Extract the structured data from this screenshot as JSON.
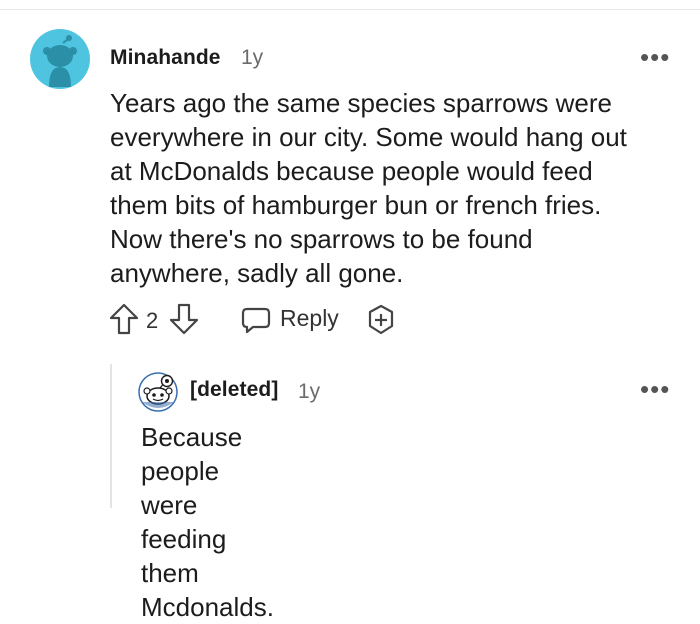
{
  "comments": [
    {
      "author": "Minahande",
      "age": "1y",
      "body_lines": [
        "Years ago the same species sparrows were",
        "everywhere in our city. Some would hang out",
        "at McDonalds because people would feed",
        "them bits of hamburger bun or french fries.",
        "Now there's no sparrows to be found",
        "anywhere, sadly all gone."
      ],
      "votes": "2",
      "reply_label": "Reply",
      "more_label": "•••"
    },
    {
      "author": "[deleted]",
      "age": "1y",
      "body_lines": [
        "Because people were feeding them",
        "Mcdonalds."
      ],
      "more_label": "•••"
    }
  ],
  "colors": {
    "avatar1_bg": "#4fc4e0",
    "avatar1_alien": "#2b8fa8",
    "text": "#1c1c1c",
    "muted": "#6b6b6b",
    "thread_line": "#e3e3e3"
  },
  "icons": [
    "snoo-avatar-icon",
    "upvote-icon",
    "downvote-icon",
    "reply-bubble-icon",
    "award-plus-icon",
    "deleted-snoo-avatar-icon",
    "more-options-icon"
  ]
}
